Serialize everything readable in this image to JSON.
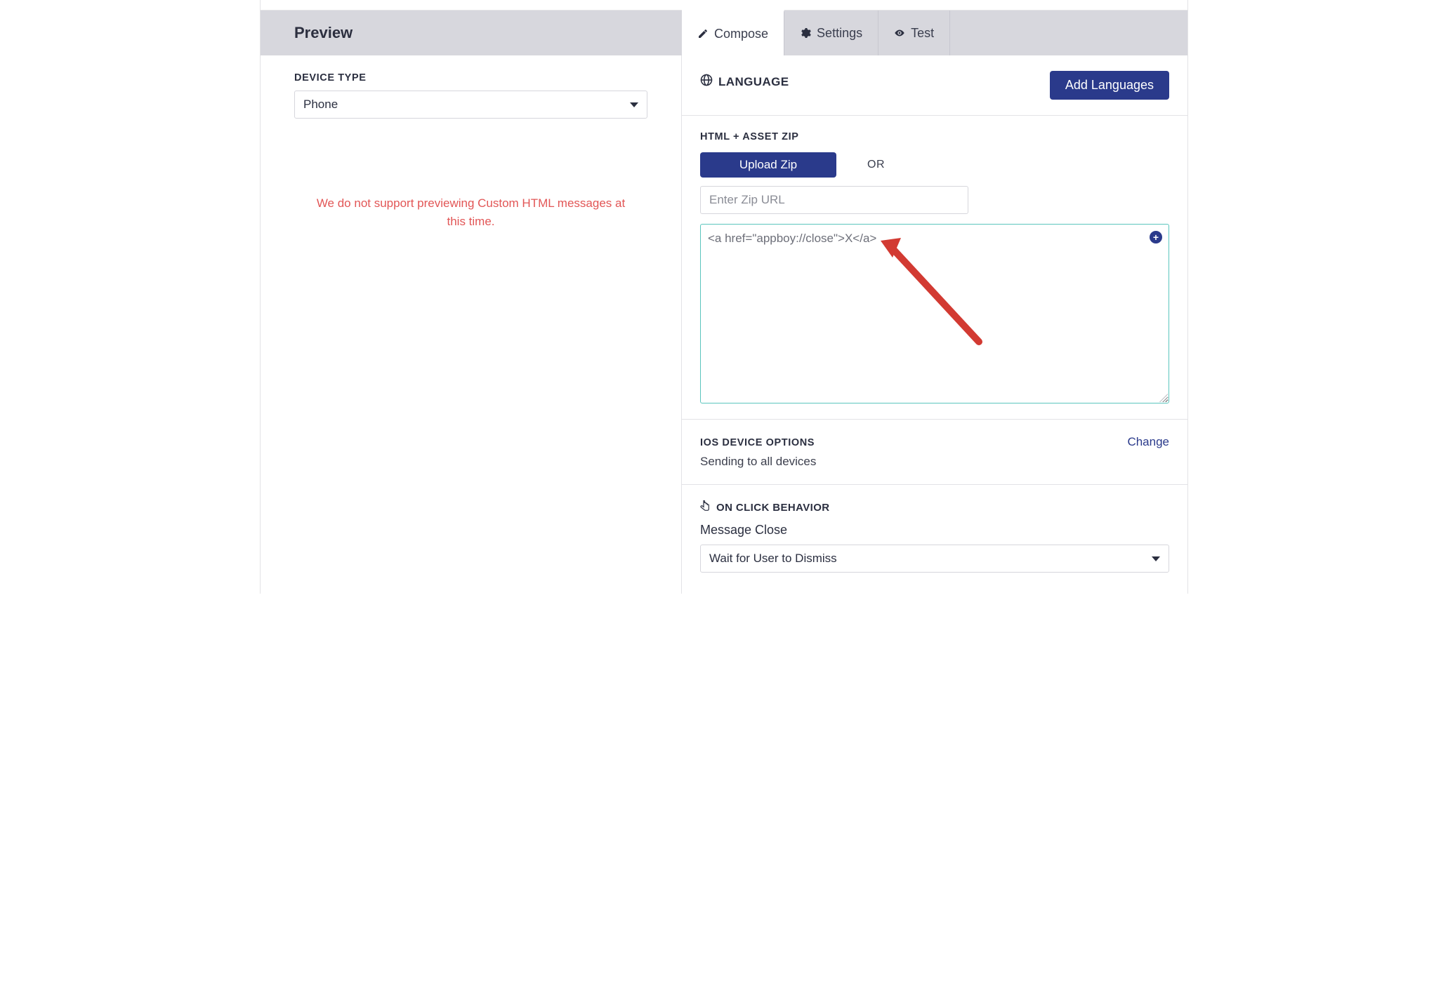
{
  "header": {
    "preview_title": "Preview",
    "tabs": {
      "compose": "Compose",
      "settings": "Settings",
      "test": "Test"
    }
  },
  "left": {
    "device_type_label": "DEVICE TYPE",
    "device_type_value": "Phone",
    "preview_warning": "We do not support previewing Custom HTML messages at this time."
  },
  "compose": {
    "language_label": "LANGUAGE",
    "add_languages_button": "Add Languages",
    "html_zip_label": "HTML + ASSET ZIP",
    "upload_zip_button": "Upload Zip",
    "or_text": "OR",
    "zip_url_placeholder": "Enter Zip URL",
    "code_value": "<a href=\"appboy://close\">X</a>",
    "ios_options_label": "IOS DEVICE OPTIONS",
    "change_link": "Change",
    "ios_options_value": "Sending to all devices",
    "on_click_label": "ON CLICK BEHAVIOR",
    "message_close_label": "Message Close",
    "message_close_value": "Wait for User to Dismiss"
  }
}
